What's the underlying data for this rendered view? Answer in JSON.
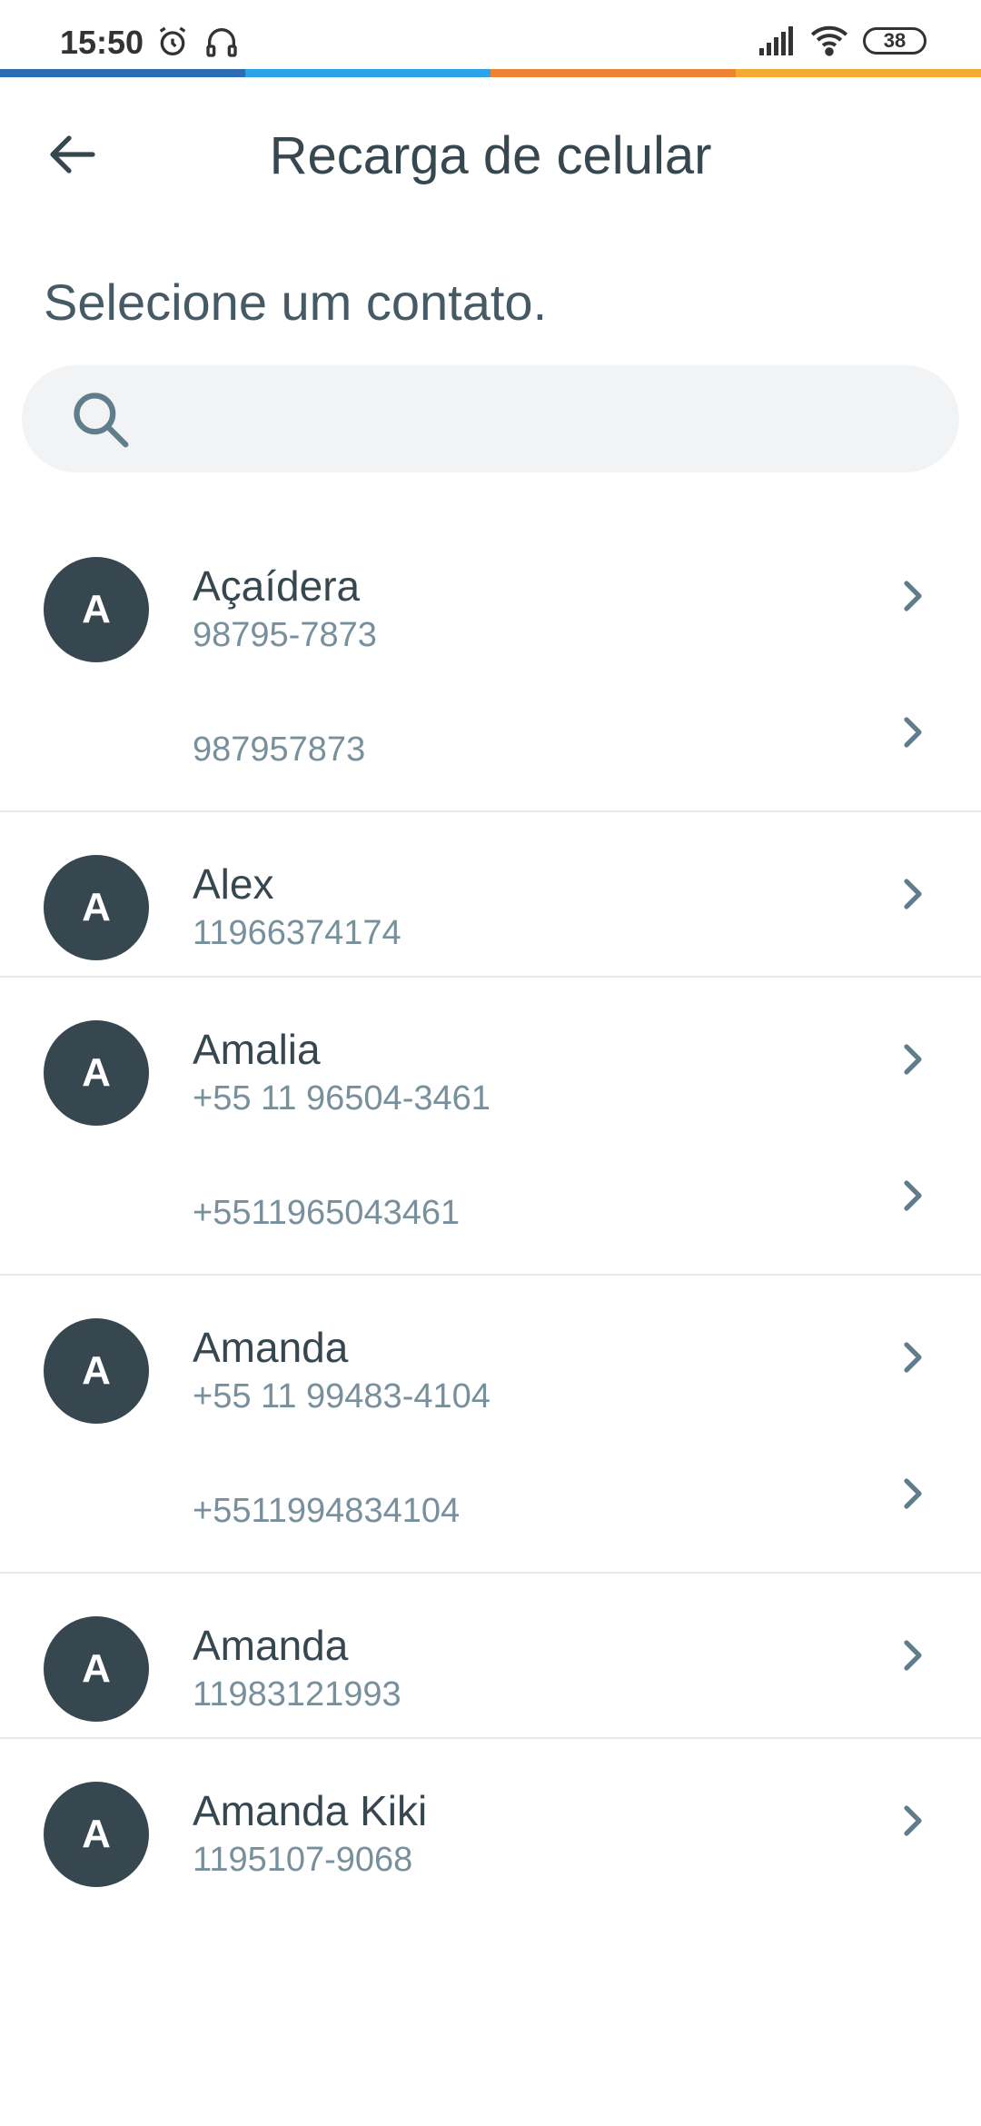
{
  "status_bar": {
    "time": "15:50",
    "battery": "38",
    "icons": [
      "alarm-icon",
      "headphones-icon",
      "signal-icon",
      "wifi-icon",
      "battery-icon"
    ]
  },
  "brand_colors": [
    "#2f6db3",
    "#2ea2e6",
    "#ee8433",
    "#f3ab33"
  ],
  "header": {
    "title": "Recarga de celular",
    "back_icon": "arrow-left-icon"
  },
  "main": {
    "subtitle": "Selecione um contato.",
    "search": {
      "placeholder": "",
      "value": "",
      "icon": "search-icon"
    },
    "contacts": [
      {
        "initial": "A",
        "name": "Açaídera",
        "numbers": [
          "98795-7873",
          "987957873"
        ]
      },
      {
        "initial": "A",
        "name": "Alex",
        "numbers": [
          "11966374174"
        ]
      },
      {
        "initial": "A",
        "name": "Amalia",
        "numbers": [
          "+55 11 96504-3461",
          "+5511965043461"
        ]
      },
      {
        "initial": "A",
        "name": "Amanda",
        "numbers": [
          "+55 11 99483-4104",
          "+5511994834104"
        ]
      },
      {
        "initial": "A",
        "name": "Amanda",
        "numbers": [
          "11983121993"
        ]
      },
      {
        "initial": "A",
        "name": "Amanda Kiki",
        "numbers": [
          "1195107-9068"
        ]
      }
    ]
  }
}
